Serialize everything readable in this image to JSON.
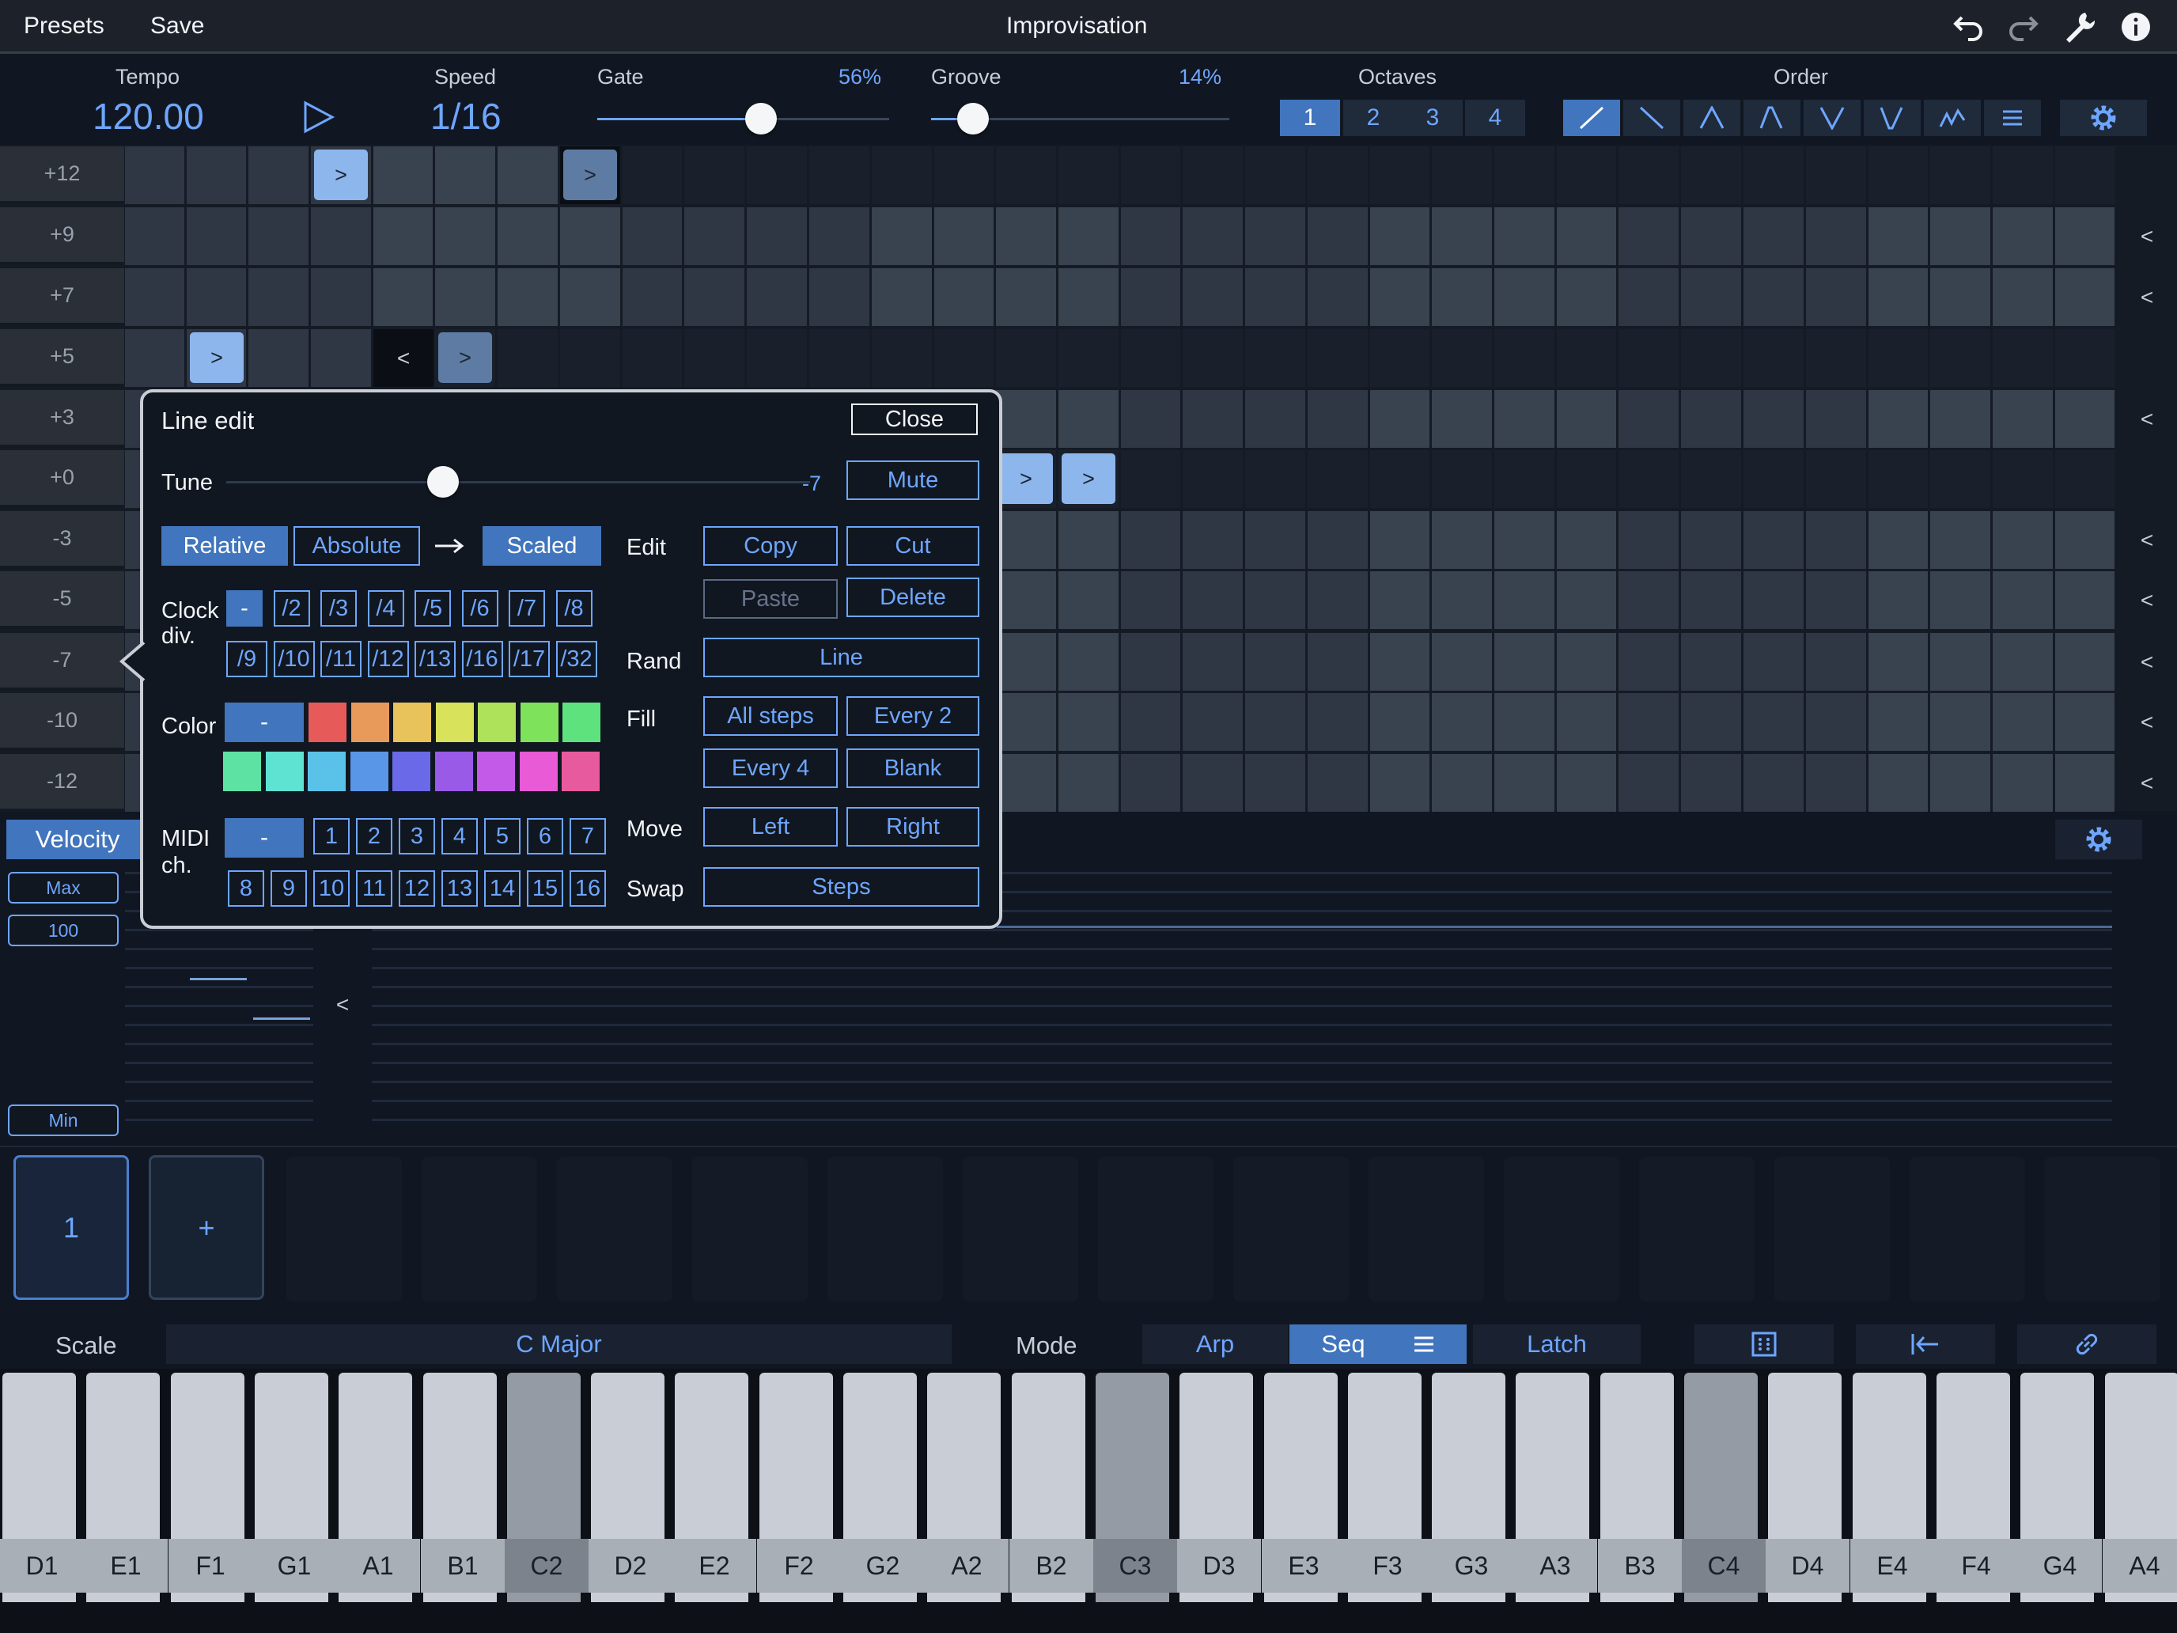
{
  "app": {
    "title": "Improvisation",
    "presets": "Presets",
    "save": "Save"
  },
  "transport": {
    "tempo_label": "Tempo",
    "tempo": "120.00",
    "speed_label": "Speed",
    "speed": "1/16",
    "gate_label": "Gate",
    "gate_value": "56%",
    "gate_level": 0.56,
    "groove_label": "Groove",
    "groove_value": "14%",
    "groove_level": 0.14,
    "octaves_label": "Octaves",
    "octaves": [
      "1",
      "2",
      "3",
      "4"
    ],
    "octave_selected": "1",
    "order_label": "Order",
    "order_icons": [
      "order-up-icon",
      "order-down-icon",
      "order-up-down-icon",
      "order-up-down-repeat-icon",
      "order-down-up-icon",
      "order-down-up-repeat-icon",
      "order-random-icon",
      "order-as-played-icon"
    ]
  },
  "grid": {
    "rows": [
      "+12",
      "+9",
      "+7",
      "+5",
      "+3",
      "+0",
      "-3",
      "-5",
      "-7",
      "-10",
      "-12"
    ],
    "step_glyph": ">",
    "end_glyph": "<"
  },
  "popup": {
    "title": "Line edit",
    "close": "Close",
    "tune_label": "Tune",
    "tune_value": "-7",
    "mute": "Mute",
    "relative": "Relative",
    "absolute": "Absolute",
    "scaled": "Scaled",
    "edit_label": "Edit",
    "copy": "Copy",
    "cut": "Cut",
    "paste": "Paste",
    "delete": "Delete",
    "clock_label": "Clock",
    "clock_label2": "div.",
    "clock_row1": [
      "-",
      "/2",
      "/3",
      "/4",
      "/5",
      "/6",
      "/7",
      "/8"
    ],
    "clock_row2": [
      "/9",
      "/10",
      "/11",
      "/12",
      "/13",
      "/16",
      "/17",
      "/32"
    ],
    "rand_label": "Rand",
    "line": "Line",
    "color_label": "Color",
    "color_none": "-",
    "colors_row1": [
      "#e65a5a",
      "#e89a5a",
      "#e8c25a",
      "#d8e25a",
      "#aee25a",
      "#7ee25a",
      "#5ee27e"
    ],
    "colors_row2": [
      "#5ee2a4",
      "#5ee2d2",
      "#5ac2e8",
      "#5a96e8",
      "#6a6ae8",
      "#9a5ae8",
      "#c45ae8",
      "#e85ad6",
      "#e85a9e"
    ],
    "fill_label": "Fill",
    "all_steps": "All steps",
    "every2": "Every 2",
    "every4": "Every 4",
    "blank": "Blank",
    "midi_label": "MIDI",
    "midi_label2": "ch.",
    "midi_none": "-",
    "midi_row1": [
      "1",
      "2",
      "3",
      "4",
      "5",
      "6",
      "7"
    ],
    "midi_row2": [
      "8",
      "9",
      "10",
      "11",
      "12",
      "13",
      "14",
      "15",
      "16"
    ],
    "move_label": "Move",
    "left": "Left",
    "right": "Right",
    "swap_label": "Swap",
    "steps": "Steps"
  },
  "lane": {
    "velocity": "Velocity",
    "max": "Max",
    "max_value": "100",
    "min": "Min",
    "end_glyph": "<"
  },
  "patterns": {
    "first": "1",
    "add": "+"
  },
  "bottom": {
    "scale_label": "Scale",
    "scale_value": "C Major",
    "mode_label": "Mode",
    "arp": "Arp",
    "seq": "Seq",
    "latch": "Latch"
  },
  "keys": [
    "D1",
    "E1",
    "F1",
    "G1",
    "A1",
    "B1",
    "C2",
    "D2",
    "E2",
    "F2",
    "G2",
    "A2",
    "B2",
    "C3",
    "D3",
    "E3",
    "F3",
    "G3",
    "A3",
    "B3",
    "C4",
    "D4",
    "E4",
    "F4",
    "G4",
    "A4"
  ]
}
